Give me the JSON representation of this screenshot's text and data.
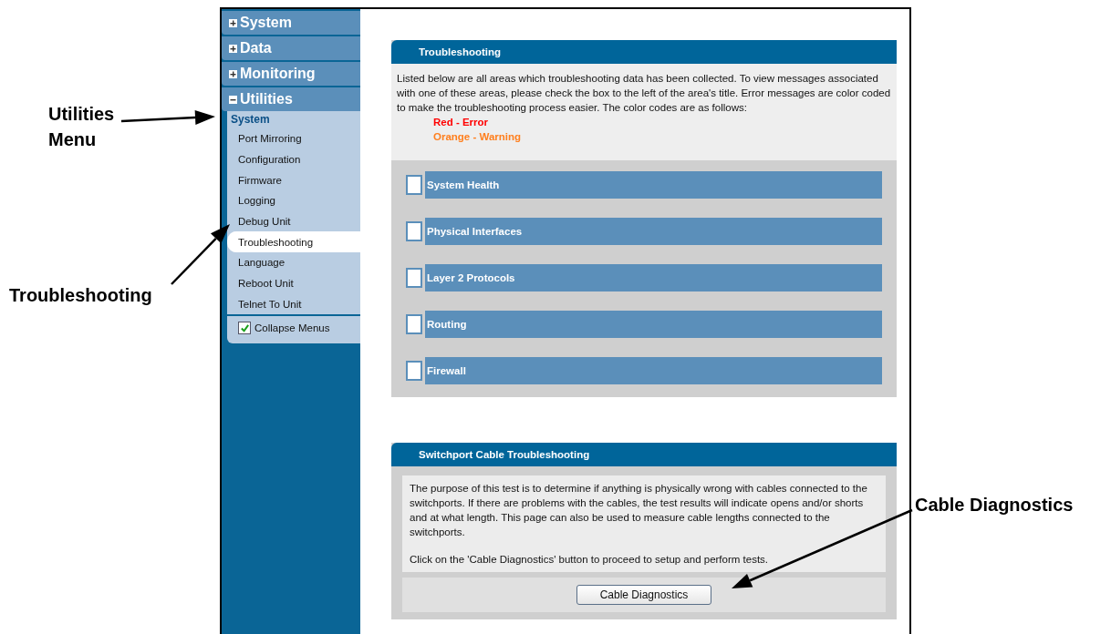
{
  "callouts": [
    {
      "label": "Utilities Menu"
    },
    {
      "label": "Troubleshooting"
    },
    {
      "label": "Cable Diagnostics"
    }
  ],
  "sidebar": {
    "menus": [
      {
        "label": "System",
        "expanded": false
      },
      {
        "label": "Data",
        "expanded": false
      },
      {
        "label": "Monitoring",
        "expanded": false
      },
      {
        "label": "Utilities",
        "expanded": true
      }
    ],
    "section": "System",
    "items": [
      {
        "label": "Port Mirroring",
        "selected": false
      },
      {
        "label": "Configuration",
        "selected": false
      },
      {
        "label": "Firmware",
        "selected": false
      },
      {
        "label": "Logging",
        "selected": false
      },
      {
        "label": "Debug Unit",
        "selected": false
      },
      {
        "label": "Troubleshooting",
        "selected": true
      },
      {
        "label": "Language",
        "selected": false
      },
      {
        "label": "Reboot Unit",
        "selected": false
      },
      {
        "label": "Telnet To Unit",
        "selected": false
      }
    ],
    "collapse": {
      "label": "Collapse Menus",
      "checked": true
    }
  },
  "troubleshooting": {
    "title": "Troubleshooting",
    "intro": "Listed below are all areas which troubleshooting data has been collected. To view messages associated with one of these areas, please check the box to the left of the area's title. Error messages are color coded to make the troubleshooting process easier. The color codes are as follows:",
    "legend": [
      {
        "label": "Red - Error",
        "color": "#ff0000"
      },
      {
        "label": "Orange - Warning",
        "color": "#ff7f1e"
      }
    ],
    "areas": [
      {
        "label": "System Health",
        "checked": false
      },
      {
        "label": "Physical Interfaces",
        "checked": false
      },
      {
        "label": "Layer 2 Protocols",
        "checked": false
      },
      {
        "label": "Routing",
        "checked": false
      },
      {
        "label": "Firewall",
        "checked": false
      }
    ]
  },
  "cable": {
    "title": "Switchport Cable Troubleshooting",
    "description": "The purpose of this test is to determine if anything is physically wrong with cables connected to the switchports. If there are problems with the cables, the test results will indicate opens and/or shorts and at what length. This page can also be used to measure cable lengths connected to the switchports.",
    "instruction": "Click on the 'Cable Diagnostics' button to proceed to setup and perform tests.",
    "button": "Cable Diagnostics"
  }
}
